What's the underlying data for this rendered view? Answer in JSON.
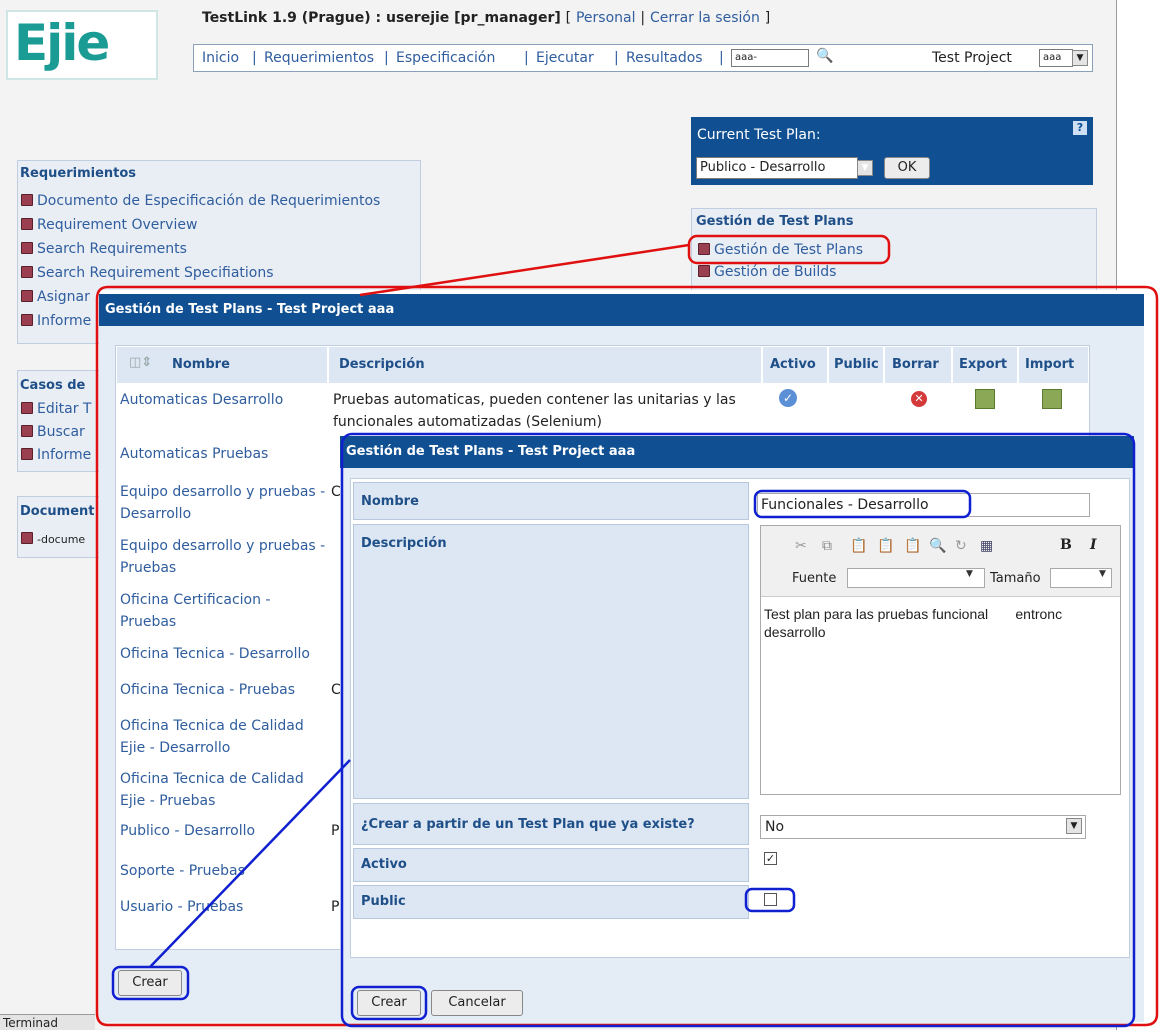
{
  "header": {
    "logo_text": "Ejie",
    "title_bold": "TestLink 1.9 (Prague) : userejie [pr_manager]",
    "bracket_open": "[",
    "personal": "Personal",
    "pipe": "|",
    "logout": "Cerrar la sesión",
    "bracket_close": "]",
    "nav": [
      "Inicio",
      "Requerimientos",
      "Especificación",
      "Ejecutar",
      "Resultados"
    ],
    "search_value": "aaa-",
    "test_project_label": "Test Project",
    "test_project_value": "aaa"
  },
  "current_plan": {
    "label": "Current Test Plan:",
    "help": "?",
    "value": "Publico - Desarrollo",
    "ok": "OK"
  },
  "requirements_menu": {
    "title": "Requerimientos",
    "items": [
      "Documento de Especificación de Requerimientos",
      "Requirement Overview",
      "Search Requirements",
      "Search Requirement Specifiations",
      "Asignar",
      "Informe"
    ]
  },
  "testcases_menu": {
    "title": "Casos de",
    "items": [
      "Editar T",
      "Buscar",
      "Informe"
    ]
  },
  "docs_menu": {
    "title": "Document",
    "items": [
      "-docume"
    ]
  },
  "gestion_menu": {
    "title": "Gestión de Test Plans",
    "items": [
      "Gestión de Test Plans",
      "Gestión de Builds"
    ]
  },
  "main_dialog": {
    "title": "Gestión de Test Plans - Test Project aaa",
    "columns": [
      "Nombre",
      "Descripción",
      "Activo",
      "Public",
      "Borrar",
      "Export",
      "Import"
    ],
    "rows": [
      {
        "name": "Automaticas Desarrollo",
        "desc": "Pruebas automaticas, pueden contener las unitarias y las funcionales automatizadas (Selenium)"
      },
      {
        "name": "Automaticas Pruebas",
        "desc": ""
      },
      {
        "name": "Equipo desarrollo y pruebas - Desarrollo",
        "desc": "C"
      },
      {
        "name": "Equipo desarrollo y pruebas - Pruebas",
        "desc": ""
      },
      {
        "name": "Oficina Certificacion - Pruebas",
        "desc": ""
      },
      {
        "name": "Oficina Tecnica - Desarrollo",
        "desc": ""
      },
      {
        "name": "Oficina Tecnica - Pruebas",
        "desc": "C"
      },
      {
        "name": "Oficina Tecnica de Calidad Ejie - Desarrollo",
        "desc": ""
      },
      {
        "name": "Oficina Tecnica de Calidad Ejie - Pruebas",
        "desc": ""
      },
      {
        "name": "Publico - Desarrollo",
        "desc": "P"
      },
      {
        "name": "Soporte - Pruebas",
        "desc": ""
      },
      {
        "name": "Usuario - Pruebas",
        "desc": "P"
      }
    ],
    "create_button": "Crear"
  },
  "form_dialog": {
    "title": "Gestión de Test Plans - Test Project aaa",
    "nombre_label": "Nombre",
    "nombre_value": "Funcionales - Desarrollo",
    "descripcion_label": "Descripción",
    "editor_font_label": "Fuente",
    "editor_size_label": "Tamaño",
    "editor_text": "Test plan para las pruebas funcional       entronc desarrollo",
    "from_existing_label": "¿Crear a partir de un Test Plan que ya existe?",
    "from_existing_value": "No",
    "activo_label": "Activo",
    "public_label": "Public",
    "create_button": "Crear",
    "cancel_button": "Cancelar"
  },
  "statusbar": {
    "text": "Terminad"
  },
  "colors": {
    "header_blue": "#0f4f92",
    "link": "#2f5d9e",
    "highlight_red": "#e01010",
    "highlight_blue": "#1020d0"
  }
}
